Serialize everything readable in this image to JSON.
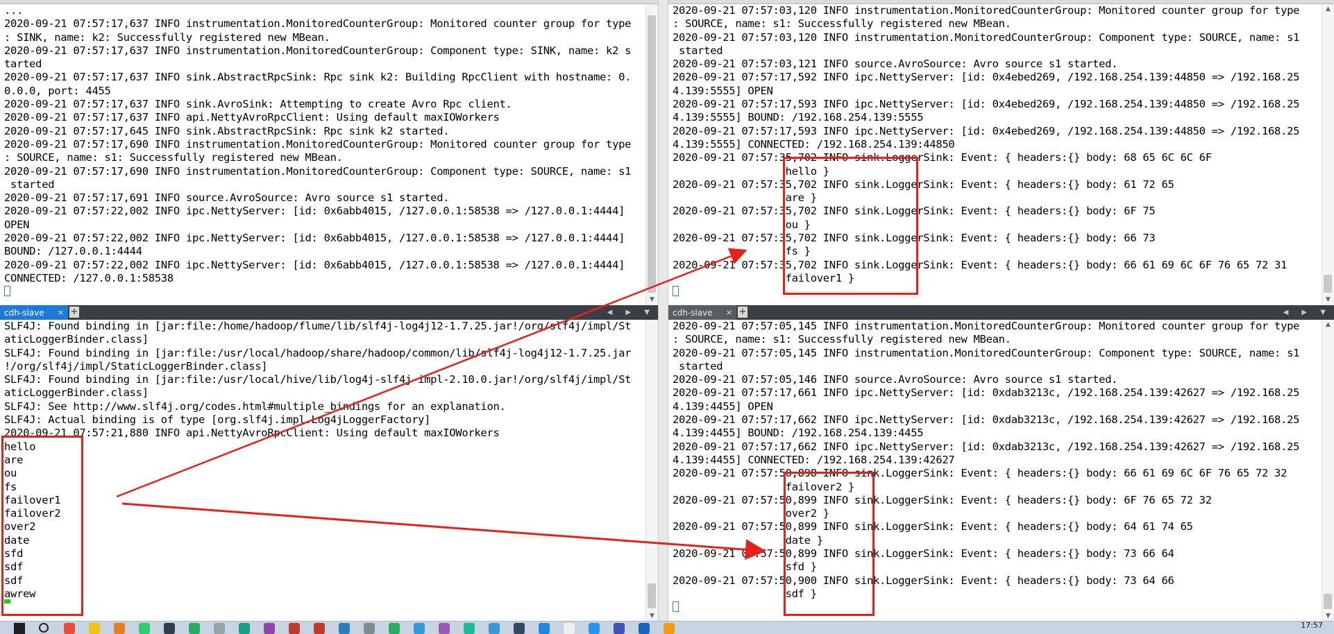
{
  "panes": {
    "top_left": {
      "lines": [
        "...",
        "2020-09-21 07:57:17,637 INFO instrumentation.MonitoredCounterGroup: Monitored counter group for type",
        ": SINK, name: k2: Successfully registered new MBean.",
        "2020-09-21 07:57:17,637 INFO instrumentation.MonitoredCounterGroup: Component type: SINK, name: k2 s",
        "tarted",
        "2020-09-21 07:57:17,637 INFO sink.AbstractRpcSink: Rpc sink k2: Building RpcClient with hostname: 0.",
        "0.0.0, port: 4455",
        "2020-09-21 07:57:17,637 INFO sink.AvroSink: Attempting to create Avro Rpc client.",
        "2020-09-21 07:57:17,637 INFO api.NettyAvroRpcClient: Using default maxIOWorkers",
        "2020-09-21 07:57:17,645 INFO sink.AbstractRpcSink: Rpc sink k2 started.",
        "2020-09-21 07:57:17,690 INFO instrumentation.MonitoredCounterGroup: Monitored counter group for type",
        ": SOURCE, name: s1: Successfully registered new MBean.",
        "2020-09-21 07:57:17,690 INFO instrumentation.MonitoredCounterGroup: Component type: SOURCE, name: s1",
        " started",
        "2020-09-21 07:57:17,691 INFO source.AvroSource: Avro source s1 started.",
        "2020-09-21 07:57:22,002 INFO ipc.NettyServer: [id: 0x6abb4015, /127.0.0.1:58538 => /127.0.0.1:4444]",
        "OPEN",
        "2020-09-21 07:57:22,002 INFO ipc.NettyServer: [id: 0x6abb4015, /127.0.0.1:58538 => /127.0.0.1:4444]",
        "BOUND: /127.0.0.1:4444",
        "2020-09-21 07:57:22,002 INFO ipc.NettyServer: [id: 0x6abb4015, /127.0.0.1:58538 => /127.0.0.1:4444]",
        "CONNECTED: /127.0.0.1:58538"
      ]
    },
    "top_right": {
      "lines": [
        "2020-09-21 07:57:03,120 INFO instrumentation.MonitoredCounterGroup: Monitored counter group for type",
        ": SOURCE, name: s1: Successfully registered new MBean.",
        "2020-09-21 07:57:03,120 INFO instrumentation.MonitoredCounterGroup: Component type: SOURCE, name: s1",
        " started",
        "2020-09-21 07:57:03,121 INFO source.AvroSource: Avro source s1 started.",
        "2020-09-21 07:57:17,592 INFO ipc.NettyServer: [id: 0x4ebed269, /192.168.254.139:44850 => /192.168.25",
        "4.139:5555] OPEN",
        "2020-09-21 07:57:17,593 INFO ipc.NettyServer: [id: 0x4ebed269, /192.168.254.139:44850 => /192.168.25",
        "4.139:5555] BOUND: /192.168.254.139:5555",
        "2020-09-21 07:57:17,593 INFO ipc.NettyServer: [id: 0x4ebed269, /192.168.254.139:44850 => /192.168.25",
        "4.139:5555] CONNECTED: /192.168.254.139:44850",
        "2020-09-21 07:57:35,702 INFO sink.LoggerSink: Event: { headers:{} body: 68 65 6C 6C 6F",
        "                  hello }",
        "2020-09-21 07:57:35,702 INFO sink.LoggerSink: Event: { headers:{} body: 61 72 65",
        "                  are }",
        "2020-09-21 07:57:35,702 INFO sink.LoggerSink: Event: { headers:{} body: 6F 75",
        "                  ou }",
        "2020-09-21 07:57:35,702 INFO sink.LoggerSink: Event: { headers:{} body: 66 73",
        "                  fs }",
        "2020-09-21 07:57:35,702 INFO sink.LoggerSink: Event: { headers:{} body: 66 61 69 6C 6F 76 65 72 31",
        "                  failover1 }"
      ]
    },
    "bottom_left": {
      "tab_label": "cdh-slave",
      "lines": [
        "SLF4J: Found binding in [jar:file:/home/hadoop/flume/lib/slf4j-log4j12-1.7.25.jar!/org/slf4j/impl/St",
        "aticLoggerBinder.class]",
        "SLF4J: Found binding in [jar:file:/usr/local/hadoop/share/hadoop/common/lib/slf4j-log4j12-1.7.25.jar",
        "!/org/slf4j/impl/StaticLoggerBinder.class]",
        "SLF4J: Found binding in [jar:file:/usr/local/hive/lib/log4j-slf4j-impl-2.10.0.jar!/org/slf4j/impl/St",
        "aticLoggerBinder.class]",
        "SLF4J: See http://www.slf4j.org/codes.html#multiple_bindings for an explanation.",
        "SLF4J: Actual binding is of type [org.slf4j.impl.Log4jLoggerFactory]",
        "2020-09-21 07:57:21,880 INFO api.NettyAvroRpcClient: Using default maxIOWorkers",
        "hello",
        "are",
        "ou",
        "fs",
        "failover1",
        "failover2",
        "over2",
        "date",
        "sfd",
        "sdf",
        "sdf",
        "awrew"
      ]
    },
    "bottom_right": {
      "tab_label": "cdh-slave",
      "lines": [
        "2020-09-21 07:57:05,145 INFO instrumentation.MonitoredCounterGroup: Monitored counter group for type",
        ": SOURCE, name: s1: Successfully registered new MBean.",
        "2020-09-21 07:57:05,145 INFO instrumentation.MonitoredCounterGroup: Component type: SOURCE, name: s1",
        " started",
        "2020-09-21 07:57:05,146 INFO source.AvroSource: Avro source s1 started.",
        "2020-09-21 07:57:17,661 INFO ipc.NettyServer: [id: 0xdab3213c, /192.168.254.139:42627 => /192.168.25",
        "4.139:4455] OPEN",
        "2020-09-21 07:57:17,662 INFO ipc.NettyServer: [id: 0xdab3213c, /192.168.254.139:42627 => /192.168.25",
        "4.139:4455] BOUND: /192.168.254.139:4455",
        "2020-09-21 07:57:17,662 INFO ipc.NettyServer: [id: 0xdab3213c, /192.168.254.139:42627 => /192.168.25",
        "4.139:4455] CONNECTED: /192.168.254.139:42627",
        "2020-09-21 07:57:50,898 INFO sink.LoggerSink: Event: { headers:{} body: 66 61 69 6C 6F 76 65 72 32",
        "                  failover2 }",
        "2020-09-21 07:57:50,899 INFO sink.LoggerSink: Event: { headers:{} body: 6F 76 65 72 32",
        "                  over2 }",
        "2020-09-21 07:57:50,899 INFO sink.LoggerSink: Event: { headers:{} body: 64 61 74 65",
        "                  date }",
        "2020-09-21 07:57:50,899 INFO sink.LoggerSink: Event: { headers:{} body: 73 66 64",
        "                  sfd }",
        "2020-09-21 07:57:50,900 INFO sink.LoggerSink: Event: { headers:{} body: 73 64 66",
        "                  sdf }"
      ]
    }
  },
  "tab_close_glyph": "×",
  "tab_add_glyph": "+",
  "tab_arrows": "◀ ▶ ▼",
  "scroll_up": "▲",
  "scroll_down": "▼",
  "taskbar": {
    "clock": "17:57",
    "icons": [
      "start-icon",
      "search-icon",
      "chrome-icon",
      "file-explorer-icon",
      "app-icon",
      "wechat-icon",
      "jetbrains-icon",
      "chat-icon",
      "notepad-icon",
      "pycharm-icon",
      "phpstorm-icon",
      "app-icon",
      "xmind-icon",
      "app-icon",
      "app-icon",
      "app-icon",
      "app-icon",
      "app-icon",
      "app-icon",
      "app-icon",
      "app-icon",
      "app-icon",
      "app-icon",
      "app-icon",
      "app-icon",
      "app-icon",
      "app-icon"
    ]
  },
  "colors": {
    "annotation_red": "#e8201a",
    "tab_active": "#1c7ad8",
    "tab_bar": "#3b3f44",
    "cursor_green": "#15d415"
  }
}
